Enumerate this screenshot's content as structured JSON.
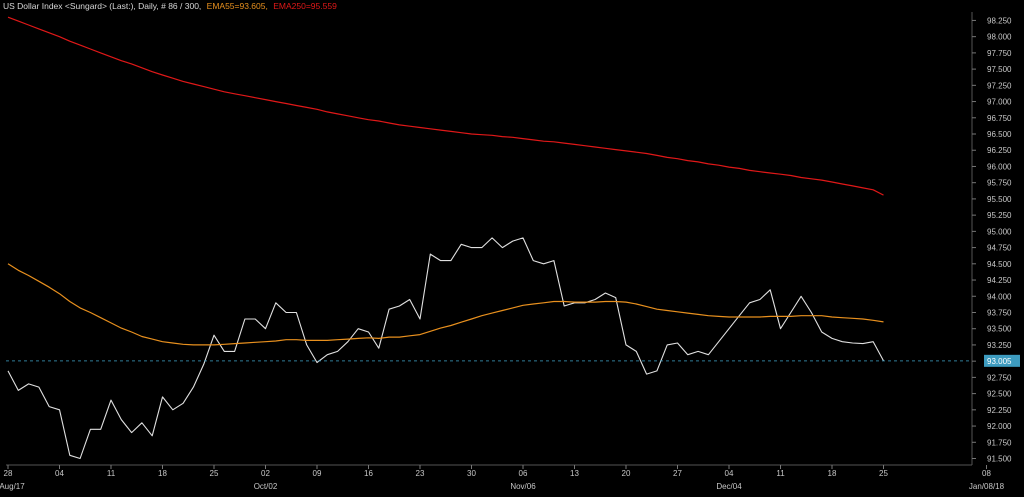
{
  "header": {
    "title": "US Dollar Index <Sungard> (Last:), Daily, # 86 / 300,",
    "ema55_label": "EMA55=93.605,",
    "ema250_label": "EMA250=95.559"
  },
  "colors": {
    "background": "#000000",
    "price": "#e0e0e0",
    "ema55": "#e8901e",
    "ema250": "#e01818",
    "last_badge": "#3d9bbf",
    "grid": "#1c1c1c"
  },
  "chart_data": {
    "type": "line",
    "title": "US Dollar Index <Sungard> (Last:), Daily, # 86 / 300,",
    "ylim": [
      91.4,
      98.38
    ],
    "y_ticks": [
      "98.250",
      "98.000",
      "97.750",
      "97.500",
      "97.250",
      "97.000",
      "96.750",
      "96.500",
      "96.250",
      "96.000",
      "95.750",
      "95.500",
      "95.250",
      "95.000",
      "94.750",
      "94.500",
      "94.250",
      "94.000",
      "93.750",
      "93.500",
      "93.250",
      "93.000",
      "92.750",
      "92.500",
      "92.250",
      "92.000",
      "91.750",
      "91.500"
    ],
    "x_ticks": [
      "28",
      "04",
      "11",
      "18",
      "25",
      "02",
      "09",
      "16",
      "23",
      "30",
      "06",
      "13",
      "20",
      "27",
      "04",
      "11",
      "18",
      "25",
      "08"
    ],
    "x_tick_index": [
      0,
      5,
      10,
      15,
      20,
      25,
      30,
      35,
      40,
      45,
      50,
      55,
      60,
      65,
      70,
      75,
      80,
      85,
      95
    ],
    "x_period_labels": [
      {
        "label": "Aug/17",
        "index": 0
      },
      {
        "label": "Oct/02",
        "index": 25
      },
      {
        "label": "Nov/06",
        "index": 50
      },
      {
        "label": "Dec/04",
        "index": 70
      },
      {
        "label": "Jan/08/18",
        "index": 95
      }
    ],
    "x_total_slots": 98,
    "last_value": "93.005",
    "grid": false,
    "legend": "top-left",
    "series": [
      {
        "name": "US Dollar Index",
        "values": [
          92.85,
          92.55,
          92.65,
          92.6,
          92.3,
          92.25,
          91.55,
          91.5,
          91.95,
          91.95,
          92.4,
          92.1,
          91.9,
          92.05,
          91.85,
          92.45,
          92.25,
          92.35,
          92.6,
          92.95,
          93.4,
          93.15,
          93.15,
          93.65,
          93.65,
          93.5,
          93.9,
          93.75,
          93.75,
          93.25,
          92.98,
          93.1,
          93.15,
          93.3,
          93.5,
          93.45,
          93.2,
          93.8,
          93.85,
          93.95,
          93.65,
          94.65,
          94.55,
          94.55,
          94.8,
          94.75,
          94.75,
          94.9,
          94.75,
          94.85,
          94.9,
          94.55,
          94.5,
          94.55,
          93.85,
          93.9,
          93.9,
          93.95,
          94.05,
          93.98,
          93.25,
          93.15,
          92.8,
          92.85,
          93.25,
          93.28,
          93.1,
          93.15,
          93.1,
          93.3,
          93.5,
          93.7,
          93.9,
          93.95,
          94.1,
          93.5,
          93.75,
          94.0,
          93.75,
          93.45,
          93.35,
          93.3,
          93.28,
          93.27,
          93.3,
          93.005
        ],
        "color": "#e0e0e0"
      },
      {
        "name": "EMA55",
        "values": [
          94.5,
          94.4,
          94.32,
          94.23,
          94.14,
          94.04,
          93.92,
          93.82,
          93.75,
          93.67,
          93.59,
          93.51,
          93.45,
          93.38,
          93.34,
          93.3,
          93.28,
          93.26,
          93.25,
          93.25,
          93.25,
          93.26,
          93.27,
          93.28,
          93.29,
          93.3,
          93.31,
          93.33,
          93.33,
          93.32,
          93.32,
          93.32,
          93.33,
          93.34,
          93.35,
          93.36,
          93.35,
          93.37,
          93.37,
          93.39,
          93.41,
          93.46,
          93.51,
          93.55,
          93.6,
          93.65,
          93.7,
          93.74,
          93.78,
          93.82,
          93.86,
          93.88,
          93.9,
          93.92,
          93.92,
          93.91,
          93.91,
          93.91,
          93.92,
          93.92,
          93.91,
          93.88,
          93.84,
          93.8,
          93.78,
          93.76,
          93.74,
          93.72,
          93.7,
          93.69,
          93.68,
          93.68,
          93.68,
          93.68,
          93.69,
          93.69,
          93.69,
          93.7,
          93.7,
          93.7,
          93.68,
          93.67,
          93.66,
          93.65,
          93.63,
          93.605
        ],
        "color": "#e8901e"
      },
      {
        "name": "EMA250",
        "values": [
          98.3,
          98.24,
          98.18,
          98.12,
          98.06,
          98.0,
          97.93,
          97.87,
          97.81,
          97.75,
          97.69,
          97.63,
          97.58,
          97.52,
          97.46,
          97.41,
          97.36,
          97.31,
          97.27,
          97.23,
          97.19,
          97.15,
          97.12,
          97.09,
          97.06,
          97.03,
          97.0,
          96.97,
          96.94,
          96.91,
          96.88,
          96.84,
          96.81,
          96.78,
          96.75,
          96.72,
          96.7,
          96.67,
          96.64,
          96.62,
          96.6,
          96.58,
          96.56,
          96.54,
          96.52,
          96.5,
          96.49,
          96.48,
          96.46,
          96.45,
          96.43,
          96.41,
          96.39,
          96.38,
          96.36,
          96.34,
          96.32,
          96.3,
          96.28,
          96.26,
          96.24,
          96.22,
          96.2,
          96.17,
          96.14,
          96.12,
          96.09,
          96.07,
          96.04,
          96.02,
          95.99,
          95.97,
          95.94,
          95.92,
          95.9,
          95.88,
          95.86,
          95.83,
          95.81,
          95.79,
          95.76,
          95.73,
          95.7,
          95.67,
          95.64,
          95.559
        ],
        "color": "#e01818"
      }
    ]
  }
}
